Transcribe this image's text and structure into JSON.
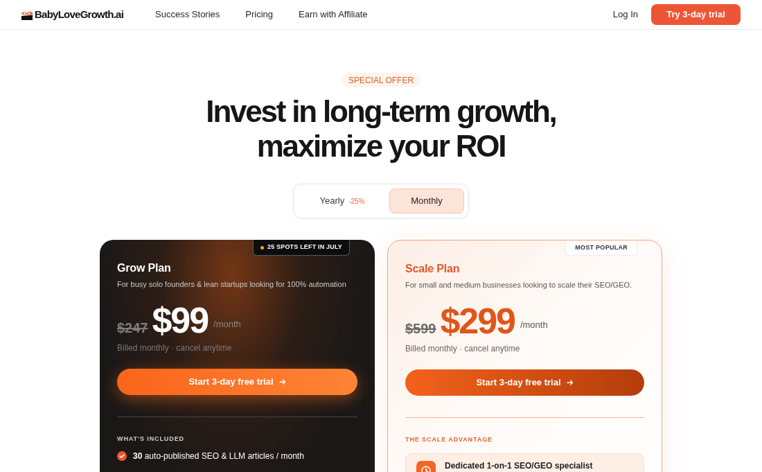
{
  "header": {
    "logo": "BabyLoveGrowth.ai",
    "nav": [
      {
        "label": "Success Stories"
      },
      {
        "label": "Pricing"
      },
      {
        "label": "Earn with Affiliate"
      }
    ],
    "login": "Log In",
    "cta": "Try 3-day trial"
  },
  "hero": {
    "badge": "SPECIAL OFFER",
    "title_lines": [
      "Invest in long-term growth,",
      "maximize your ROI"
    ]
  },
  "billing_toggle": [
    {
      "label": "Yearly",
      "discount": "-25%",
      "selected": false
    },
    {
      "label": "Monthly",
      "selected": true
    }
  ],
  "plans": [
    {
      "kind": "dark",
      "ribbon": {
        "kind": "urgency",
        "text": "25 SPOTS LEFT IN JULY"
      },
      "name": "Grow Plan",
      "description": "For busy solo founders & lean startups looking for 100% automation",
      "old_price": "$247",
      "price": "$99",
      "period": "/month",
      "billing_note": "Billed monthly · cancel anytime",
      "button": "Start 3-day free trial",
      "section_title": "WHAT'S INCLUDED",
      "features": [
        {
          "kind": "check",
          "text": "**30** auto-published SEO & LLM articles / month"
        }
      ]
    },
    {
      "kind": "highlight",
      "ribbon": {
        "kind": "popular",
        "text": "MOST POPULAR"
      },
      "name": "Scale Plan",
      "description": "For small and medium businesses looking to scale their SEO/GEO.",
      "old_price": "$599",
      "price": "$299",
      "period": "/month",
      "billing_note": "Billed monthly · cancel anytime",
      "button": "Start 3-day free trial",
      "section_title": "THE SCALE ADVANTAGE",
      "features": [
        {
          "kind": "advantage",
          "text": "Dedicated 1-on-1 SEO/GEO specialist"
        }
      ]
    }
  ]
}
